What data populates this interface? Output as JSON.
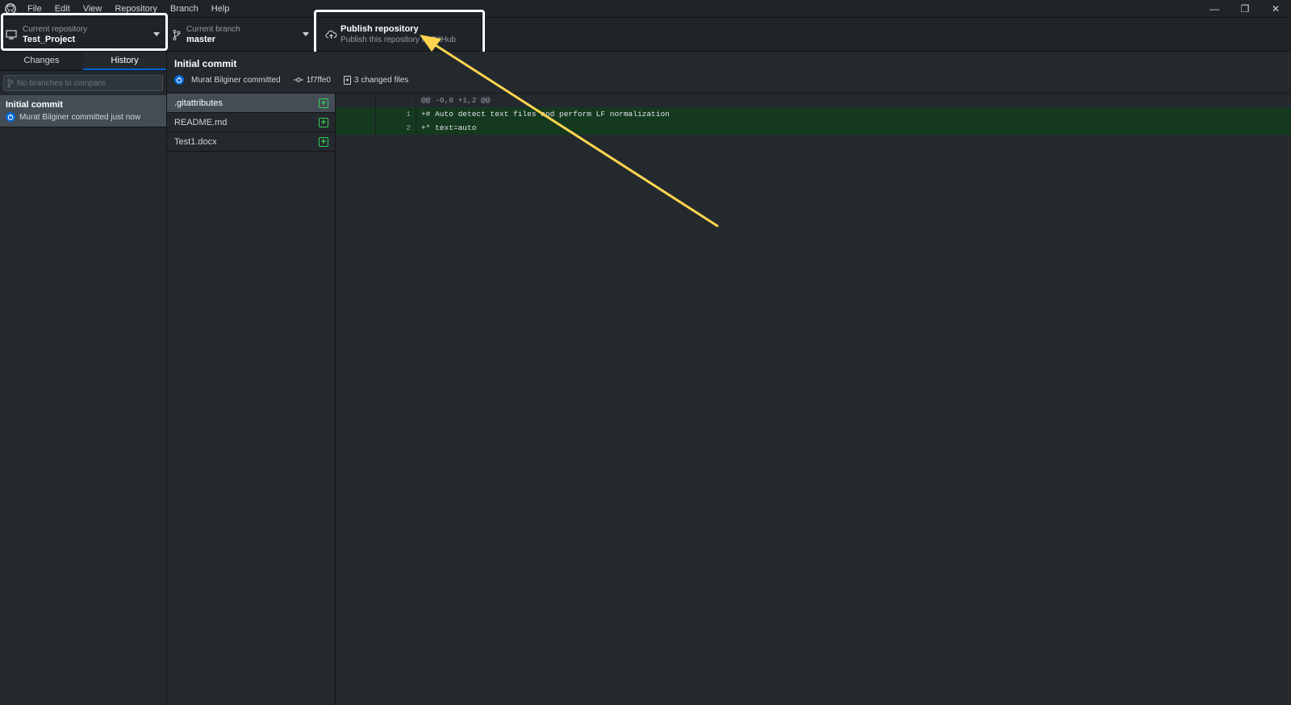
{
  "menu": [
    "File",
    "Edit",
    "View",
    "Repository",
    "Branch",
    "Help"
  ],
  "window_controls": {
    "minimize": "—",
    "restore": "❐",
    "close": "✕"
  },
  "toolbar": {
    "repo_label": "Current repository",
    "repo_value": "Test_Project",
    "branch_label": "Current branch",
    "branch_value": "master",
    "publish_title": "Publish repository",
    "publish_subtitle": "Publish this repository to GitHub"
  },
  "sidebar": {
    "tabs": [
      "Changes",
      "History"
    ],
    "active_tab": "History",
    "branch_filter_placeholder": "No branches to compare",
    "commits": [
      {
        "title": "Initial commit",
        "meta": "Murat Bilginer committed just now"
      }
    ]
  },
  "commit": {
    "title": "Initial commit",
    "author": "Murat Bilginer committed",
    "sha": "1f7ffe0",
    "changed_files": "3 changed files"
  },
  "files": [
    {
      "name": ".gitattributes",
      "selected": true
    },
    {
      "name": "README.md",
      "selected": false
    },
    {
      "name": "Test1.docx",
      "selected": false
    }
  ],
  "diff": {
    "hunk": "@@ -0,0 +1,2 @@",
    "lines": [
      {
        "num": "1",
        "text": "+# Auto detect text files and perform LF normalization"
      },
      {
        "num": "2",
        "text": "+* text=auto"
      }
    ]
  },
  "colors": {
    "highlight": "#ffffff",
    "arrow": "#ffd54f",
    "accent": "#0366d6",
    "added": "#34d058"
  }
}
